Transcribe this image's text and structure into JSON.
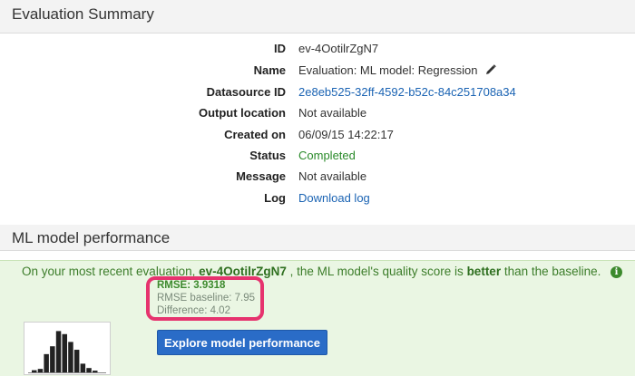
{
  "evaluation_summary": {
    "title": "Evaluation Summary",
    "rows": [
      {
        "key": "ID",
        "value": "ev-4OotilrZgN7"
      },
      {
        "key": "Name",
        "value": "Evaluation: ML model: Regression"
      },
      {
        "key": "Datasource ID",
        "value": "2e8eb525-32ff-4592-b52c-84c251708a34"
      },
      {
        "key": "Output location",
        "value": "Not available"
      },
      {
        "key": "Created on",
        "value": "06/09/15 14:22:17"
      },
      {
        "key": "Status",
        "value": "Completed"
      },
      {
        "key": "Message",
        "value": "Not available"
      },
      {
        "key": "Log",
        "value": "Download log"
      }
    ]
  },
  "ml_performance": {
    "title": "ML model performance",
    "message": {
      "prefix": "On your most recent evaluation, ",
      "eval_id": "ev-4OotilrZgN7",
      "middle": " , the ML model's quality score is ",
      "quality": "better",
      "suffix": " than the baseline."
    },
    "rmse": "RMSE: 3.9318",
    "rmse_baseline": "RMSE baseline: 7.95",
    "difference": "Difference: 4.02",
    "explore_button": "Explore model performance",
    "histogram_relative_heights": [
      0.05,
      0.08,
      0.42,
      0.6,
      0.95,
      0.88,
      0.7,
      0.52,
      0.2,
      0.1,
      0.04
    ]
  },
  "colors": {
    "link": "#1a63b3",
    "status_ok": "#2a8a2a",
    "highlight": "#e6336e",
    "button": "#2a6cc7",
    "panel": "#eaf6e3"
  },
  "icons": [
    "pencil-icon",
    "info-icon"
  ]
}
